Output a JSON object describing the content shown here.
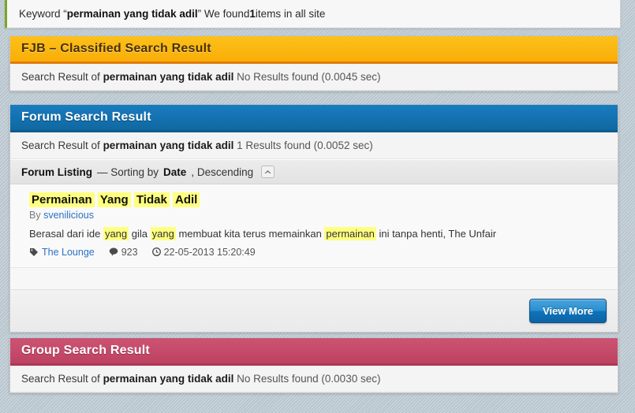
{
  "keyword_bar": {
    "prefix": "Keyword “",
    "keyword": "permainan yang tidak adil",
    "middle": "” We found ",
    "count": "1",
    "suffix": " items in all site"
  },
  "fjb_panel": {
    "title": "FJB – Classified Search Result",
    "sub_prefix": "Search Result of ",
    "sub_keyword": "permainan yang tidak adil",
    "sub_suffix": "  No Results found (0.0045 sec)"
  },
  "forum_panel": {
    "title": "Forum Search Result",
    "sub_prefix": "Search Result of ",
    "sub_keyword": "permainan yang tidak adil",
    "sub_suffix": " 1 Results found (0.0052 sec)",
    "listing": {
      "label": "Forum Listing",
      "dash": " — Sorting by ",
      "sort_field": "Date",
      "sort_order": ", Descending",
      "collapse_icon": "chevron-up-icon"
    },
    "result": {
      "title_words": [
        "Permainan",
        "Yang",
        "Tidak",
        "Adil"
      ],
      "by_label": "By ",
      "author": "svenilicious",
      "desc_part1": "Berasal dari ide ",
      "desc_hl1": "yang",
      "desc_part2": " gila ",
      "desc_hl2": "yang",
      "desc_part3": " membuat kita terus memainkan ",
      "desc_hl3": "permainan",
      "desc_part4": " ini tanpa henti, The Unfair",
      "category_icon": "tag-icon",
      "category": "The Lounge",
      "comments_icon": "comment-icon",
      "comments": "923",
      "time_icon": "clock-icon",
      "timestamp": "22-05-2013 15:20:49"
    },
    "view_more_label": "View More"
  },
  "group_panel": {
    "title": "Group Search Result",
    "sub_prefix": "Search Result of ",
    "sub_keyword": "permainan yang tidak adil",
    "sub_suffix": " No Results found (0.0030 sec)"
  },
  "colors": {
    "fjb_header": "#fbb712",
    "forum_header": "#1471b0",
    "group_header": "#c54a6a",
    "highlight": "#ffff80",
    "link": "#2a72c4",
    "accent_green": "#7ba529",
    "button_blue": "#0f74bb"
  }
}
